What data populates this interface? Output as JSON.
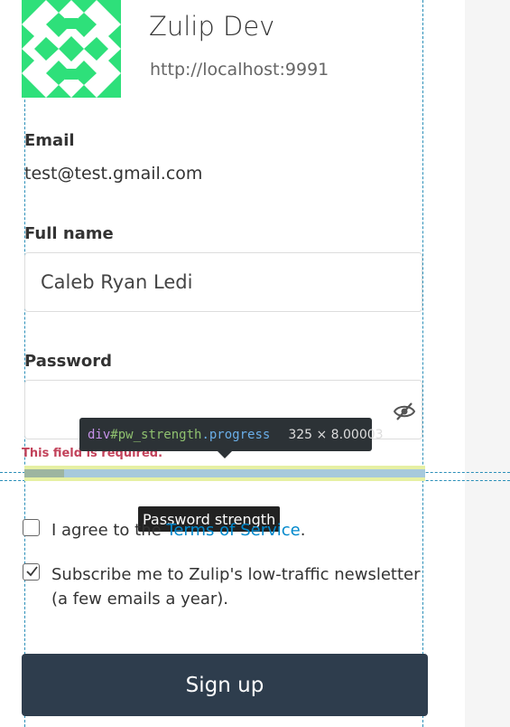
{
  "org": {
    "name": "Zulip Dev",
    "url": "http://localhost:9991",
    "logo_icon": "org-avatar-identicon",
    "logo_color": "#2ee07a"
  },
  "form": {
    "email_label": "Email",
    "email_value": "test@test.gmail.com",
    "full_name_label": "Full name",
    "full_name_value": "Caleb Ryan Ledi",
    "password_label": "Password",
    "password_value": "",
    "password_toggle_icon": "eye-slash-icon",
    "password_error": "This field is required.",
    "password_strength_fraction": 0.1,
    "password_strength_tooltip": "Password strength",
    "tos_prefix": "I agree to the ",
    "tos_link": "Terms of Service",
    "tos_suffix": ".",
    "tos_checked": false,
    "newsletter_text": "Subscribe me to Zulip's low-traffic newsletter (a few emails a year).",
    "newsletter_checked": true,
    "submit_label": "Sign up"
  },
  "devtools": {
    "tag": "div",
    "id": "#pw_strength",
    "class": ".progress",
    "dimensions": "325 × 8.00003"
  },
  "colors": {
    "button_bg": "#2e3d4d",
    "error": "#c2425a",
    "link": "#0088cc"
  }
}
